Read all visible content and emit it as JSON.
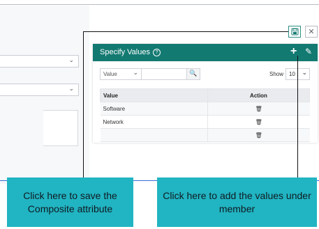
{
  "dialog": {
    "title": "Specify Values",
    "help_icon": "question-circle-icon",
    "add_icon": "plus-icon",
    "edit_icon": "pencil-icon",
    "add_glyph": "+",
    "edit_glyph": "✎",
    "help_glyph": "?",
    "filter_field_value": "Value",
    "search_icon": "search-icon",
    "show_label": "Show",
    "page_size": "10",
    "columns": [
      "Value",
      "Action"
    ],
    "rows": [
      {
        "value": "Software",
        "action_icon": "trash-icon"
      },
      {
        "value": "Network",
        "action_icon": "trash-icon"
      },
      {
        "value": "",
        "action_icon": "trash-icon"
      }
    ]
  },
  "toolbar": {
    "save_icon": "save-icon",
    "close_icon": "close-icon",
    "close_glyph": "✕"
  },
  "callouts": {
    "save": "Click here to save the Composite attribute",
    "add": "Click here to add the values under member"
  },
  "colors": {
    "header": "#137a72",
    "callout": "#21b4c2",
    "accent_line": "#2f6fd6"
  }
}
